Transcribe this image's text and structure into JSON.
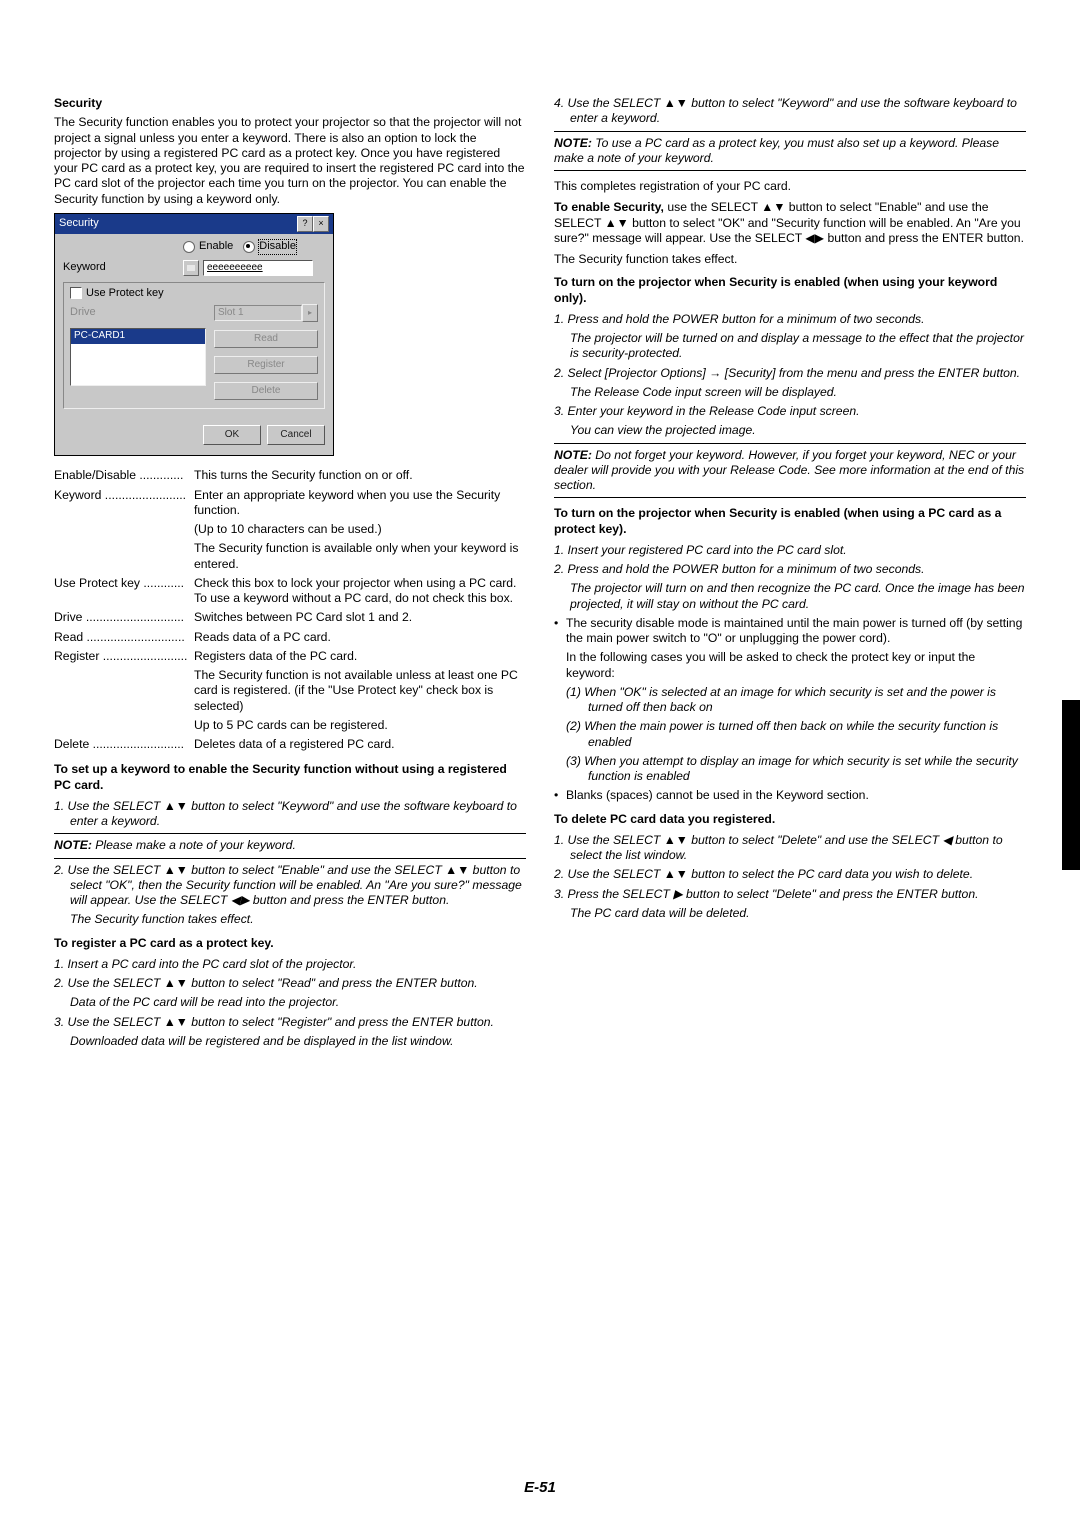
{
  "section_title": "Security",
  "intro": "The Security function enables you to protect your projector so that the projector will not project a signal unless you enter a keyword. There is also an option to lock the projector by using a registered PC card as a protect key. Once you have registered your PC card as a protect key, you are required to insert the registered PC card into the PC card slot of the projector each time you turn on the projector. You can enable the Security function by using a keyword only.",
  "dialog": {
    "title": "Security",
    "help": "?",
    "close": "×",
    "enable": "Enable",
    "disable": "Disable",
    "keyword_label": "Keyword",
    "keyword_value": "eeeeeeeeee",
    "use_protect": "Use Protect key",
    "drive_label": "Drive",
    "drive_value": "Slot 1",
    "arrow": "▸",
    "file_sel": "PC-CARD1",
    "read": "Read",
    "register": "Register",
    "delete": "Delete",
    "ok": "OK",
    "cancel": "Cancel"
  },
  "defs": {
    "enable_disable": {
      "t": "Enable/Disable .............",
      "d": "This turns the Security function on or off."
    },
    "keyword": {
      "t": "Keyword ........................",
      "d": "Enter an appropriate keyword when you use the Security function."
    },
    "keyword_n1": "(Up to 10 characters can be used.)",
    "keyword_n2": "The Security function is available only when your keyword is entered.",
    "use_protect": {
      "t": "Use Protect key ............",
      "d": "Check this box to lock your projector when using a PC card. To use a keyword without a PC card, do not check this box."
    },
    "drive": {
      "t": "Drive .............................",
      "d": "Switches between PC Card slot 1 and 2."
    },
    "read": {
      "t": "Read .............................",
      "d": "Reads data of a PC card."
    },
    "register": {
      "t": "Register .........................",
      "d": "Registers data of the PC card."
    },
    "register_n1": "The Security function is not available unless at least one PC card is registered. (if the \"Use Protect key\" check box is selected)",
    "register_n2": "Up to 5 PC cards can be registered.",
    "delete": {
      "t": "Delete ...........................",
      "d": "Deletes data of a registered PC card."
    }
  },
  "setup_heading": "To set up a keyword to enable the Security function without using a registered PC card.",
  "step_c1_1": "1. Use the SELECT ▲▼ button to select \"Keyword\" and use the software keyboard to enter a keyword.",
  "note_prefix": "NOTE:",
  "note1": " Please make a note of your keyword.",
  "step_c1_2": "2. Use the SELECT ▲▼ button to select \"Enable\" and use the SELECT ▲▼ button to select \"OK\", then the Security function will be enabled. An \"Are you sure?\" message will appear. Use the SELECT ◀▶ button and press the ENTER button.",
  "step_c1_2_sub": "The Security function takes effect.",
  "register_heading": "To register a PC card as a protect key.",
  "reg_1": "1. Insert a PC card into the PC card slot of the projector.",
  "reg_2": "2. Use the SELECT ▲▼ button to select \"Read\" and press the ENTER button.",
  "reg_2_sub": "Data of the PC card will be read into the projector.",
  "reg_3": "3. Use the SELECT ▲▼ button to select \"Register\" and press the ENTER button.",
  "reg_3_sub": "Downloaded data will be registered and be displayed in the list window.",
  "reg_4": "4. Use the SELECT ▲▼ button to select \"Keyword\" and use the software keyboard to enter a keyword.",
  "note2": " To use a PC card as a protect key, you must also set up a keyword. Please make a note of your keyword.",
  "completes": "This completes registration of your PC card.",
  "enable_para": {
    "pre": "To enable Security,",
    "rest": " use the SELECT ▲▼ button to select \"Enable\" and use the SELECT ▲▼ button to select \"OK\" and \"Security function will be enabled. An \"Are you sure?\" message will appear. Use the SELECT ◀▶ button and press the ENTER button."
  },
  "enable_para2": "The Security function takes effect.",
  "turnon_kw_heading": "To turn on the projector when Security is enabled (when using your keyword only).",
  "t1_1": "1. Press and hold the POWER button for a minimum of two seconds.",
  "t1_1_sub": "The projector will be turned on and display a message to the effect that the projector is security-protected.",
  "t1_2": "2. Select [Projector Options] → [Security] from the menu and press the ENTER button.",
  "t1_2_sub": "The Release Code input screen will be displayed.",
  "t1_3": "3. Enter your keyword in the Release Code input screen.",
  "t1_3_sub": "You can view the projected image.",
  "note3": " Do not forget your keyword. However, if you forget your keyword, NEC or your dealer will provide you with your Release Code. See more information at the end of this section.",
  "turnon_pc_heading": "To turn on the projector when Security is enabled (when using a PC card as a protect key).",
  "p1": "1. Insert your registered PC card into the PC card slot.",
  "p2": "2. Press and hold the POWER button for a minimum of two seconds.",
  "p2_sub": "The projector will turn on and then recognize the PC card. Once the image has been projected, it will stay on without the PC card.",
  "bullet1": "The security disable mode is maintained until the main power is turned off (by setting the main power switch to \"O\" or unplugging the power cord).",
  "bullet1b": "In the following cases you will be asked to check the protect key or input the keyword:",
  "sub1": "(1) When \"OK\" is selected at an image for which security is set and the power is turned off then back on",
  "sub2": "(2) When the main power is turned off then back on while the security function is enabled",
  "sub3": "(3) When you attempt to display an image for which security is set while the security function is enabled",
  "bullet2": "Blanks (spaces) cannot be used in the Keyword section.",
  "delete_heading": "To delete PC card data you registered.",
  "d1": "1. Use the SELECT ▲▼ button to select \"Delete\" and use the SELECT ◀ button to select the list window.",
  "d2": "2. Use the SELECT ▲▼ button to select the PC card data you wish to delete.",
  "d3": "3. Press the SELECT ▶ button to select \"Delete\" and press the ENTER button.",
  "d3_sub": "The PC card data will be deleted.",
  "page_num": "E-51"
}
